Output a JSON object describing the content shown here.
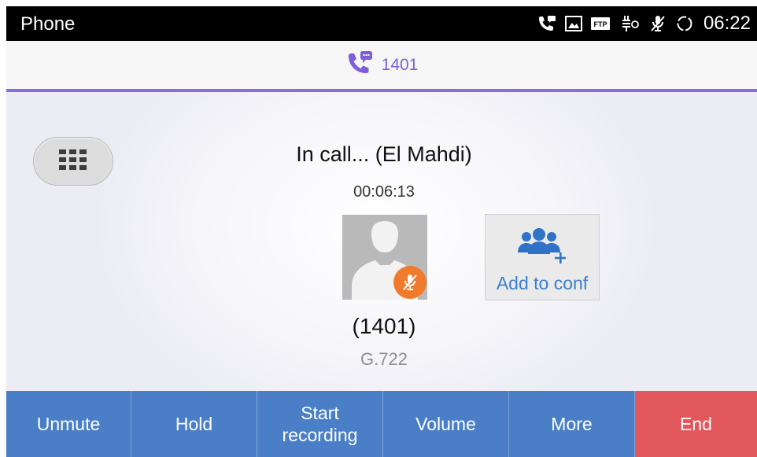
{
  "statusbar": {
    "app_title": "Phone",
    "time": "06:22",
    "icons": [
      "call-voicemail-icon",
      "image-icon",
      "ftp-icon",
      "usb-debug-icon",
      "mic-muted-icon",
      "sync-icon"
    ],
    "ftp_text": "FTP"
  },
  "tab": {
    "icon": "phone-chat-icon",
    "number": "1401"
  },
  "call": {
    "status": "In call... (El Mahdi)",
    "timer": "00:06:13",
    "caller_number": "(1401)",
    "codec": "G.722",
    "muted": true
  },
  "conference": {
    "label": "Add to conf"
  },
  "actions": {
    "unmute": "Unmute",
    "hold": "Hold",
    "start_recording_line1": "Start",
    "start_recording_line2": "recording",
    "volume": "Volume",
    "more": "More",
    "end": "End"
  },
  "colors": {
    "accent": "#8a6be0",
    "action_blue": "#4a7fc7",
    "end_red": "#e2575b",
    "muted_badge": "#f07b2c",
    "conf_text": "#3a7fd0"
  }
}
